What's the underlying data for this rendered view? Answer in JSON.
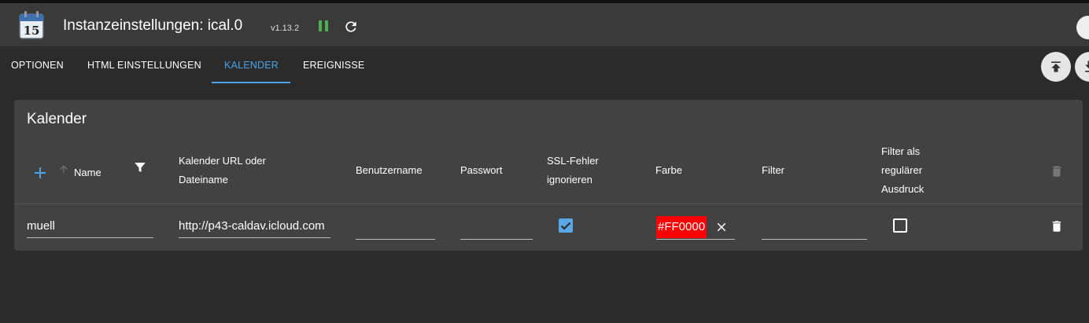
{
  "header": {
    "title": "Instanzeinstellungen: ical.0",
    "version": "v1.13.2",
    "logo_text": "15"
  },
  "tabs": [
    {
      "label": "OPTIONEN"
    },
    {
      "label": "HTML EINSTELLUNGEN"
    },
    {
      "label": "KALENDER",
      "active": true
    },
    {
      "label": "EREIGNISSE"
    }
  ],
  "panel": {
    "title": "Kalender",
    "columns": {
      "name": "Name",
      "url_line1": "Kalender URL oder",
      "url_line2": "Dateiname",
      "user": "Benutzername",
      "password": "Passwort",
      "ssl_line1": "SSL-Fehler",
      "ssl_line2": "ignorieren",
      "color": "Farbe",
      "filter": "Filter",
      "regex_line1": "Filter als",
      "regex_line2": "regulärer",
      "regex_line3": "Ausdruck"
    },
    "rows": [
      {
        "name": "muell",
        "url": "http://p43-caldav.icloud.com",
        "user": "",
        "password": "",
        "ssl_ignore": true,
        "color": "#FF0000",
        "filter": "",
        "regex": false
      }
    ]
  },
  "colors": {
    "accent": "#4aa3e8",
    "chip": "#ff0000",
    "play_green": "#4caf50"
  },
  "icons": [
    "calendar-logo-icon",
    "pause-icon",
    "reload-icon",
    "upload-icon",
    "download-icon",
    "add-icon",
    "sort-arrow-icon",
    "filter-icon",
    "delete-icon",
    "clear-icon",
    "checkbox-icon"
  ]
}
